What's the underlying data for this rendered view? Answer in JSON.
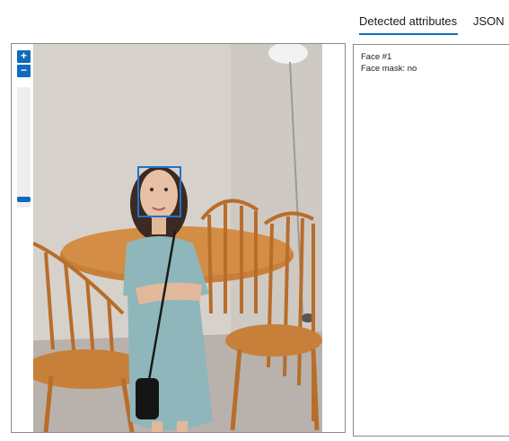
{
  "tabs": [
    {
      "label": "Detected attributes",
      "active": true
    },
    {
      "label": "JSON",
      "active": false
    }
  ],
  "viewer": {
    "zoom_in_label": "+",
    "zoom_out_label": "−",
    "zoom_level": 0.05,
    "accent_color": "#0f6cbd",
    "face_box_color": "#1f73d1"
  },
  "attributes": {
    "face_title": "Face #1",
    "face_mask": "Face mask: no"
  }
}
